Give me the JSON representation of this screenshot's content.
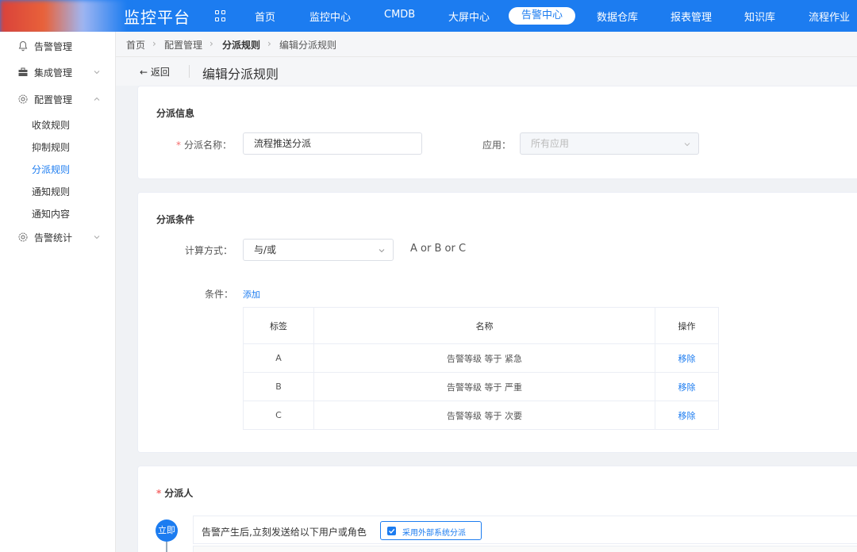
{
  "nav": {
    "brand": "监控平台",
    "items": [
      {
        "label": "首页"
      },
      {
        "label": "监控中心"
      },
      {
        "label": "CMDB"
      },
      {
        "label": "大屏中心"
      },
      {
        "label": "告警中心",
        "active": true
      },
      {
        "label": "数据仓库"
      },
      {
        "label": "报表管理"
      },
      {
        "label": "知识库"
      },
      {
        "label": "流程作业"
      }
    ]
  },
  "sidebar": {
    "groups": [
      {
        "label": "告警管理",
        "icon": "bell-icon"
      },
      {
        "label": "集成管理",
        "icon": "briefcase-icon"
      },
      {
        "label": "配置管理",
        "icon": "gear-icon"
      },
      {
        "label": "告警统计",
        "icon": "gear-icon"
      }
    ],
    "sub_items": [
      {
        "label": "收敛规则"
      },
      {
        "label": "抑制规则"
      },
      {
        "label": "分派规则",
        "active": true
      },
      {
        "label": "通知规则"
      },
      {
        "label": "通知内容"
      }
    ]
  },
  "breadcrumb": [
    "首页",
    "配置管理",
    "分派规则",
    "编辑分派规则"
  ],
  "header": {
    "back_label": "← 返回",
    "title": "编辑分派规则"
  },
  "info_section": {
    "title": "分派信息",
    "name_label": "分派名称：",
    "name_value": "流程推送分派",
    "app_label": "应用：",
    "app_placeholder": "所有应用"
  },
  "condition_section": {
    "title": "分派条件",
    "calc_label": "计算方式：",
    "calc_value": "与/或",
    "calc_hint": "A or B or C",
    "cond_label": "条件：",
    "add_link": "添加",
    "table": {
      "headers": [
        "标签",
        "名称",
        "操作"
      ],
      "rows": [
        {
          "tag": "A",
          "name": "告警等级 等于 紧急",
          "action": "移除"
        },
        {
          "tag": "B",
          "name": "告警等级 等于 严重",
          "action": "移除"
        },
        {
          "tag": "C",
          "name": "告警等级 等于 次要",
          "action": "移除"
        }
      ]
    }
  },
  "assign_section": {
    "title": "分派人",
    "step_label": "立即",
    "row_text": "告警产生后,立刻发送给以下用户或角色",
    "external_checkbox": "采用外部系统分派",
    "external_checked": true
  },
  "colors": {
    "primary": "#1c7cf0",
    "required": "#f56c6c"
  }
}
